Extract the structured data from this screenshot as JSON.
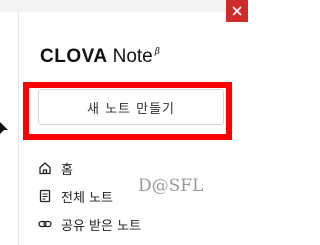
{
  "logo": {
    "brand": "CLOVA",
    "product": "Note",
    "superscript": "β"
  },
  "new_note_button": {
    "label": "새 노트 만들기"
  },
  "nav": {
    "items": [
      {
        "label": "홈",
        "icon": "home-icon"
      },
      {
        "label": "전체 노트",
        "icon": "document-icon"
      },
      {
        "label": "공유 받은 노트",
        "icon": "link-icon"
      }
    ]
  },
  "watermark": "D@SFL",
  "colors": {
    "highlight": "#ff0000",
    "close_button": "#cf2b2b",
    "text": "#222222"
  }
}
